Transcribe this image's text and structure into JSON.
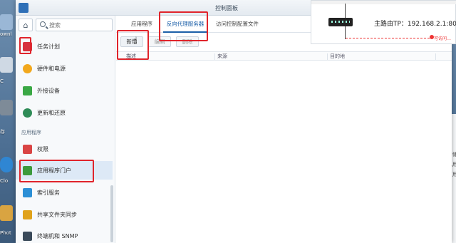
{
  "window": {
    "title": "控制面板"
  },
  "desktop": {
    "labels": [
      "ownl",
      "C",
      "存",
      "Clo",
      "Phot"
    ]
  },
  "sidebar": {
    "search_placeholder": "搜索",
    "items": [
      {
        "label": "任务计划",
        "icon": "calendar-icon",
        "color": "#d7313e"
      },
      {
        "label": "硬件和电源",
        "icon": "lightbulb-icon",
        "color": "#f2a81d"
      },
      {
        "label": "外接设备",
        "icon": "upload-icon",
        "color": "#3aa845"
      },
      {
        "label": "更新和还原",
        "icon": "refresh-icon",
        "color": "#2e8b57"
      },
      {
        "label": "权限",
        "icon": "grid-icon",
        "color": "#d94444"
      },
      {
        "label": "应用程序门户",
        "icon": "portal-icon",
        "color": "#3c9a3c"
      },
      {
        "label": "索引服务",
        "icon": "index-icon",
        "color": "#2b8fd6"
      },
      {
        "label": "共享文件夹同步",
        "icon": "folder-sync-icon",
        "color": "#e0a21a"
      },
      {
        "label": "终端机和 SNMP",
        "icon": "terminal-icon",
        "color": "#3a4a5a"
      }
    ],
    "section_label": "应用程序"
  },
  "tabs": [
    {
      "label": "应用程序"
    },
    {
      "label": "反向代理服务器"
    },
    {
      "label": "访问控制配置文件"
    }
  ],
  "toolbar": {
    "new_label": "新增",
    "edit_label": "编辑",
    "delete_label": "删除"
  },
  "table": {
    "headers": [
      "描述",
      "来源",
      "目的地"
    ]
  },
  "overlay": {
    "router_label": "主路由TP：192.168.2.1:80",
    "red_label": "可访问…"
  },
  "right_panel": {
    "lines": [
      "存储",
      "已用",
      "可用"
    ]
  },
  "colors": {
    "accent": "#1b5fa8",
    "annotation": "#e0242b"
  }
}
